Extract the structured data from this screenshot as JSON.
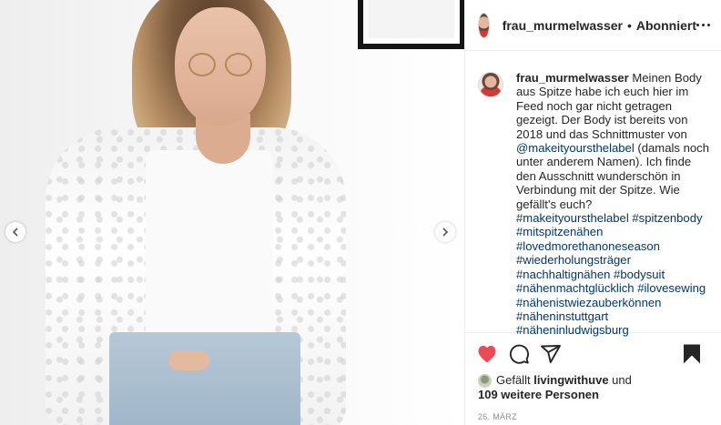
{
  "header": {
    "username": "frau_murmelwasser",
    "separator": "•",
    "follow_status": "Abonniert"
  },
  "caption": {
    "username": "frau_murmelwasser",
    "text1": " Meinen Body aus Spitze habe ich euch hier im Feed noch gar nicht getragen gezeigt. Der Body ist bereits von 2018 und das Schnittmuster von ",
    "mention": "@makeityoursthelabel",
    "text2": " (damals noch unter anderem Namen). Ich finde den Ausschnitt wunderschön in Verbindung mit der Spitze. Wie gefällt's euch?",
    "hashtags": [
      "#makeityoursthelabel",
      "#spitzenbody",
      "#mitspitzenähen",
      "#lovedmorethanoneseason",
      "#wiederholungsträger",
      "#nachhaltignähen",
      "#bodysuit",
      "#nähenmachtglücklich",
      "#ilovesewing",
      "#nähenistwiezauberkönnen",
      "#näheninstuttgart",
      "#näheninludwigsburg"
    ]
  },
  "likes": {
    "prefix": "Gefällt",
    "user": "livingwithuve",
    "conjunction": "und",
    "others": "109 weitere Personen"
  },
  "date": "26. März",
  "icons": {
    "heart": "heart-filled-icon",
    "comment": "comment-icon",
    "share": "share-icon",
    "bookmark": "bookmark-filled-icon",
    "more": "more-options-icon",
    "prev": "chevron-left-icon",
    "next": "chevron-right-icon"
  },
  "colors": {
    "like_red": "#ed4956",
    "link_blue": "#00376b",
    "text": "#262626",
    "muted": "#8e8e8e"
  }
}
